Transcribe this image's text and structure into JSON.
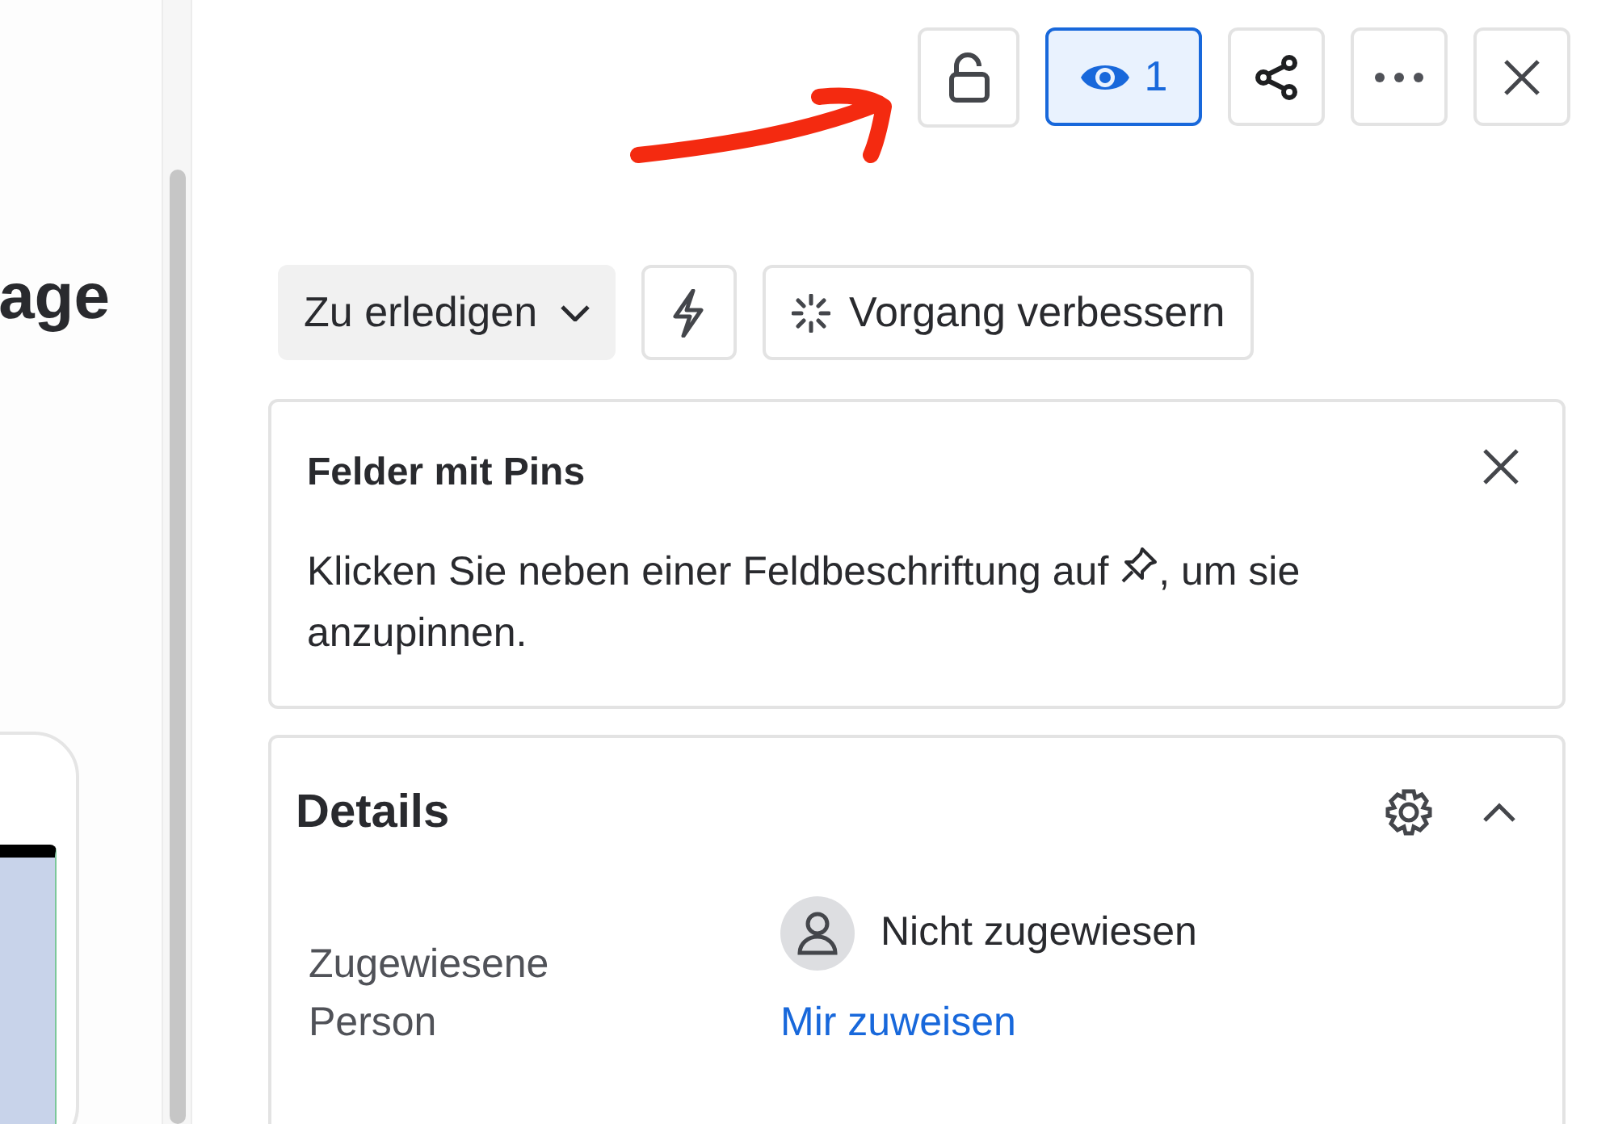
{
  "left_panel": {
    "heading": "age"
  },
  "toolbar": {
    "watchers": {
      "count": "1",
      "selected": true
    }
  },
  "actions": {
    "status": "Zu erledigen",
    "improve": "Vorgang verbessern"
  },
  "pinned_fields": {
    "title": "Felder mit Pins",
    "hint_before": "Klicken Sie neben einer Feldbeschriftung auf",
    "hint_after": ", um sie",
    "hint_end": "anzupinnen."
  },
  "details": {
    "title": "Details",
    "expanded": true,
    "fields": [
      {
        "label": "Zugewiesene Person",
        "value": "Nicht zugewiesen",
        "link": "Mir zuweisen"
      }
    ]
  }
}
